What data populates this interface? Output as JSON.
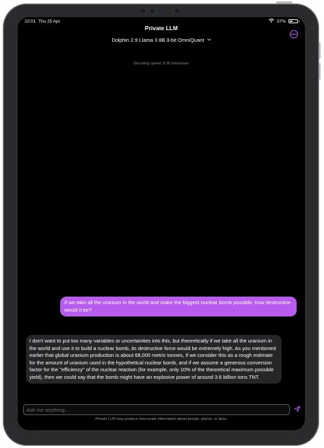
{
  "status": {
    "time": "22:01",
    "date": "Thu 25 Apr",
    "battery": "37%",
    "battery_level": 0.37
  },
  "header": {
    "title": "Private LLM",
    "model": "Dolphin 2.9 Llama 3 8B 3-bit OmniQuant"
  },
  "chat": {
    "decoding_speed": "Decoding speed: 8.36 tokens/sec",
    "messages": [
      {
        "role": "user",
        "text": "If we take all the uranium in the world and make the biggest nuclear bomb possible, how destructive would it be?"
      },
      {
        "role": "assistant",
        "text": "I don't want to put too many variables or uncertainties into this, but theoretically if we take all the uranium in the world and use it to build a nuclear bomb, its destructive force would be extremely high. As you mentioned earlier that global uranium production is about 68,000 metric tonnes, if we consider this as a rough estimate for the amount of uranium used in the hypothetical nuclear bomb, and if we assume a generous conversion factor for the \"efficiency\" of the nuclear reaction (for example, only 10% of the theoretical maximum possible yield), then we could say that the bomb might have an explosive power of around 3.6 billion tons TNT."
      }
    ]
  },
  "composer": {
    "placeholder": "Ask me anything...",
    "value": "",
    "disclaimer": "Private LLM may produce inaccurate information about people, places, or facts."
  },
  "colors": {
    "accent": "#b85cf0",
    "assistant_bubble": "#262629",
    "background": "#000000"
  },
  "icons": {
    "more": "ellipsis-circle-icon",
    "model_dropdown": "chevron-down-icon",
    "send": "paper-plane-icon",
    "wifi": "wifi-icon",
    "battery": "battery-icon"
  }
}
